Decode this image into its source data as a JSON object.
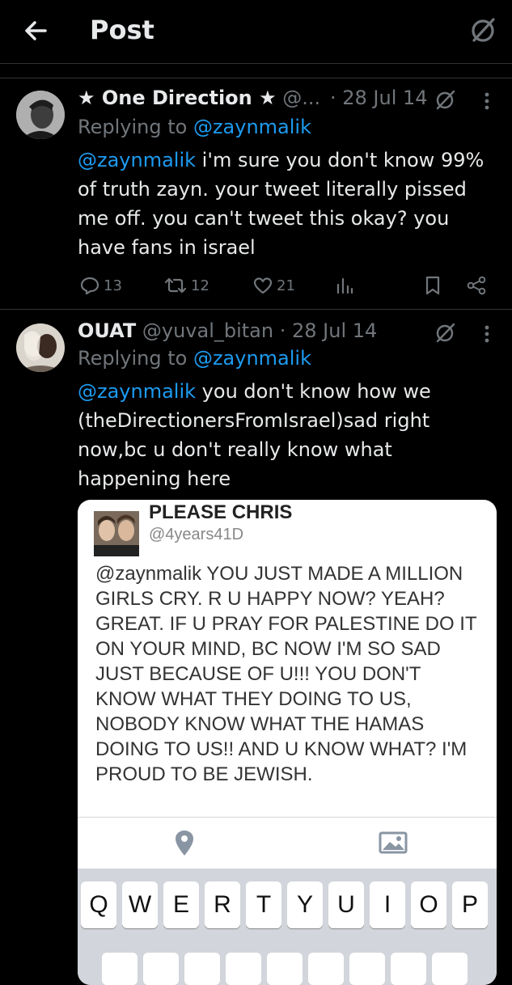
{
  "header": {
    "title": "Post"
  },
  "posts": [
    {
      "name": "★ One Direction ★",
      "handle": "@...",
      "date": "· 28 Jul 14",
      "replying_prefix": "Replying to ",
      "replying_to": "@zaynmalik",
      "mention": "@zaynmalik",
      "text": " i'm sure you don't know 99% of truth zayn. your tweet literally pissed me off. you can't tweet this okay? you have fans in israel",
      "replies": "13",
      "reposts": "12",
      "likes": "21"
    },
    {
      "name": "OUAT",
      "handle": "@yuval_bitan",
      "date": "· 28 Jul 14",
      "replying_prefix": "Replying to ",
      "replying_to": "@zaynmalik",
      "mention": "@zaynmalik",
      "text": " you don't know how we (theDirectionersFromIsrael)sad right now,bc u don't really know what happening here"
    }
  ],
  "media": {
    "name": "PLEASE CHRIS",
    "handle": "@4years41D",
    "text": "@zaynmalik YOU JUST MADE A MILLION GIRLS CRY. R U HAPPY NOW? YEAH? GREAT. IF U PRAY FOR PALESTINE DO IT ON YOUR MIND, BC NOW I'M SO SAD JUST BECAUSE OF U!!! YOU DON'T KNOW WHAT THEY DOING TO US, NOBODY KNOW WHAT THE HAMAS DOING TO US!! AND U KNOW WHAT? I'M PROUD TO BE JEWISH.",
    "keys": [
      "Q",
      "W",
      "E",
      "R",
      "T",
      "Y",
      "U",
      "I",
      "O",
      "P"
    ]
  },
  "icons": {
    "back": "arrow-left-icon",
    "grok": "grok-icon",
    "more": "more-icon",
    "reply": "reply-icon",
    "repost": "repost-icon",
    "like": "heart-icon",
    "views": "views-icon",
    "bookmark": "bookmark-icon",
    "share": "share-icon",
    "location": "location-pin-icon",
    "image": "image-icon"
  },
  "colors": {
    "background": "#000000",
    "text": "#e7e9ea",
    "muted": "#71767b",
    "link": "#1d9bf0"
  }
}
